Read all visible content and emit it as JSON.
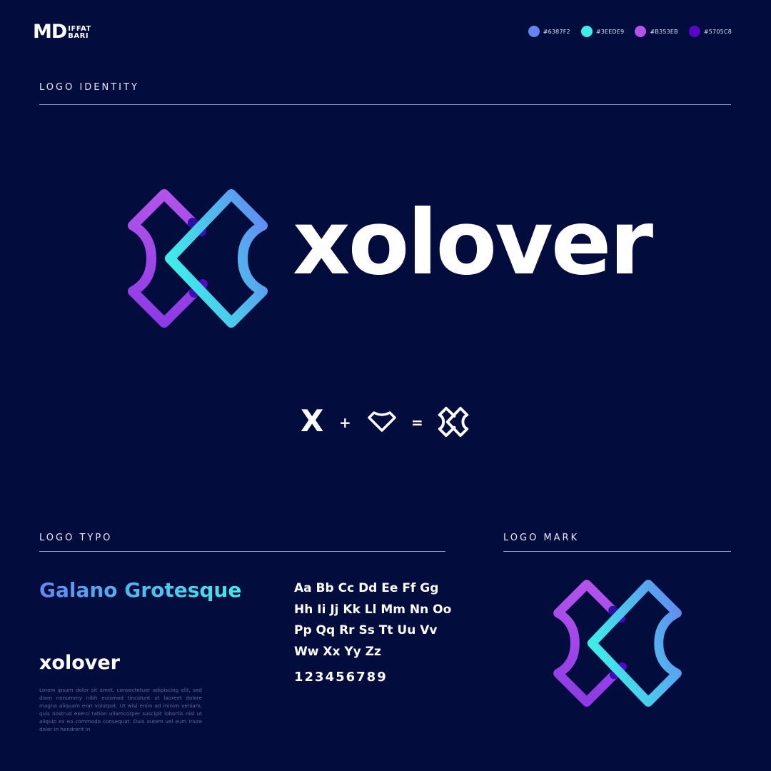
{
  "brand": {
    "mark": "MD",
    "name_line1": "IFFAT",
    "name_line2": "BARI"
  },
  "palette": [
    {
      "code": "#6387F2",
      "color": "#6387F2"
    },
    {
      "code": "#3EEDE9",
      "color": "#3EEDE9"
    },
    {
      "code": "#B353EB",
      "color": "#B353EB"
    },
    {
      "code": "#5705C8",
      "color": "#5705C8"
    }
  ],
  "sections": {
    "identity": "LOGO IDENTITY",
    "typo": "LOGO TYPO",
    "mark": "LOGO MARK"
  },
  "logo": {
    "wordmark": "xolover",
    "icon": "xolover-mark-icon"
  },
  "equation": {
    "letter": "X",
    "plus": "+",
    "equals": "=",
    "shape_icon": "heart-outline-icon",
    "result_icon": "xolover-mark-outline-icon"
  },
  "typography": {
    "font_name": "Galano Grotesque",
    "alphabet": [
      "Aa Bb Cc Dd Ee Ff Gg",
      "Hh Ii Jj Kk Ll Mm Nn Oo",
      "Pp Qq Rr Ss Tt Uu Vv",
      "Ww Xx Yy Zz"
    ],
    "digits": "123456789",
    "sample_word": "xolover",
    "lorem": "Lorem ipsum dolor sit amet, consectetuer adipiscing elit, sed diam nonummy nibh euismod tincidunt ut laoreet dolore magna aliquam erat volutpat. Ut wisi enim ad minim veniam, quis nostrud exerci tation ullamcorper suscipit lobortis nisl ut aliquip ex ea commodo consequat. Duis autem vel eum iriure dolor in hendrerit in"
  }
}
